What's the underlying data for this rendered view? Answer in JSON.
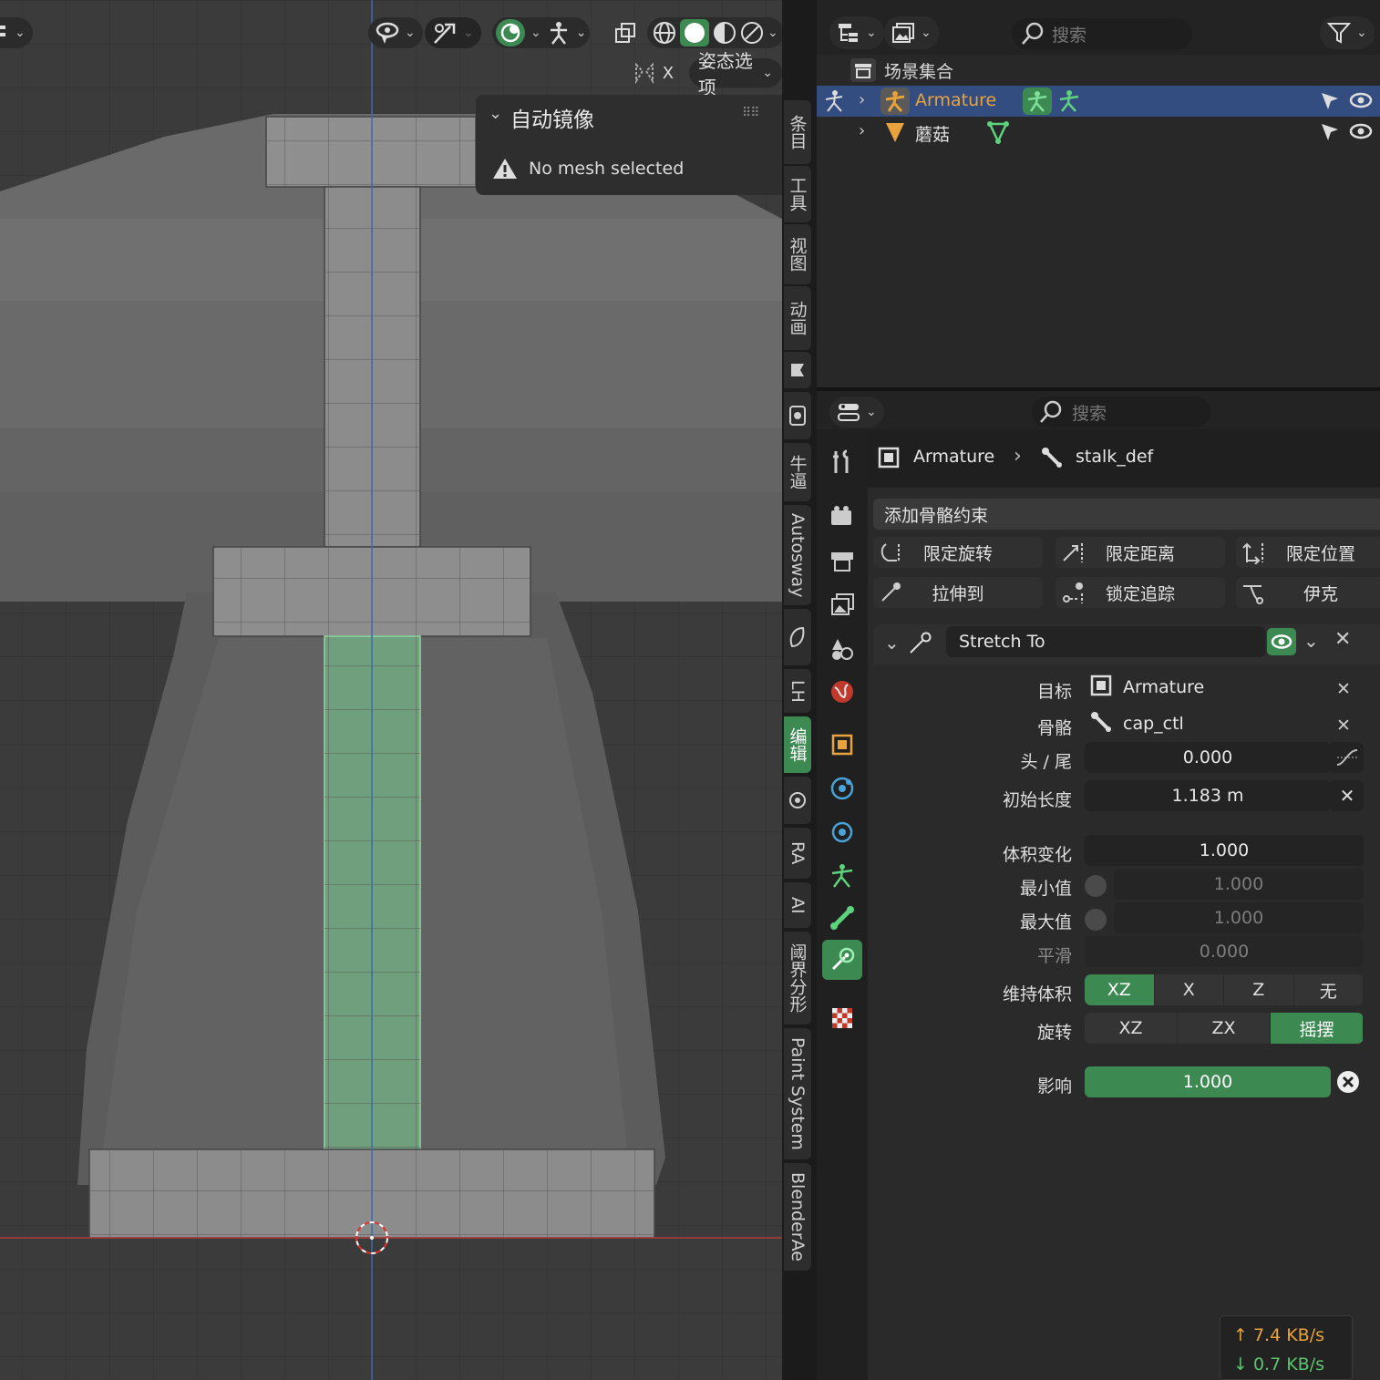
{
  "viewport": {
    "header": {
      "pose_options_label": "姿态选项",
      "x_toggle_label": "X"
    },
    "auto_mirror_panel": {
      "title": "自动镜像",
      "warning": "No mesh selected"
    }
  },
  "sidebar_tabs": [
    "条目",
    "工具",
    "视图",
    "动画",
    "牛逼",
    "Autosway",
    "LH",
    "编辑",
    "RA",
    "AI",
    "阈界分形",
    "Paint System",
    "BlenderAe"
  ],
  "sidebar_active_tab": "编辑",
  "outliner": {
    "search_placeholder": "搜索",
    "scene_collection": "场景集合",
    "items": [
      {
        "name": "Armature",
        "selected": true
      },
      {
        "name": "蘑菇",
        "selected": false
      }
    ]
  },
  "properties": {
    "search_placeholder": "搜索",
    "breadcrumb": {
      "object": "Armature",
      "bone": "stalk_def"
    },
    "add_constraint_label": "添加骨骼约束",
    "quick_constraints": [
      "限定旋转",
      "限定距离",
      "限定位置",
      "拉伸到",
      "锁定追踪",
      "伊克"
    ],
    "constraint": {
      "name": "Stretch To",
      "target_label": "目标",
      "target_value": "Armature",
      "bone_label": "骨骼",
      "bone_value": "cap_ctl",
      "head_tail_label": "头 / 尾",
      "head_tail_value": "0.000",
      "rest_length_label": "初始长度",
      "rest_length_value": "1.183 m",
      "volume_label": "体积变化",
      "volume_value": "1.000",
      "min_label": "最小值",
      "min_value": "1.000",
      "max_label": "最大值",
      "max_value": "1.000",
      "smooth_label": "平滑",
      "smooth_value": "0.000",
      "maintain_volume_label": "维持体积",
      "maintain_volume_options": [
        "XZ",
        "X",
        "Z",
        "无"
      ],
      "maintain_volume_selected": "XZ",
      "rotation_label": "旋转",
      "rotation_options": [
        "XZ",
        "ZX",
        "摇摆"
      ],
      "rotation_selected": "摇摆",
      "influence_label": "影响",
      "influence_value": "1.000",
      "influence_fraction": 1.0
    }
  },
  "network": {
    "upload": "↑ 7.4 KB/s",
    "download": "↓ 0.7 KB/s"
  },
  "colors": {
    "accent_green": "#3c8a52",
    "selection_blue": "#334d80",
    "armature_orange": "#e8a33c"
  }
}
